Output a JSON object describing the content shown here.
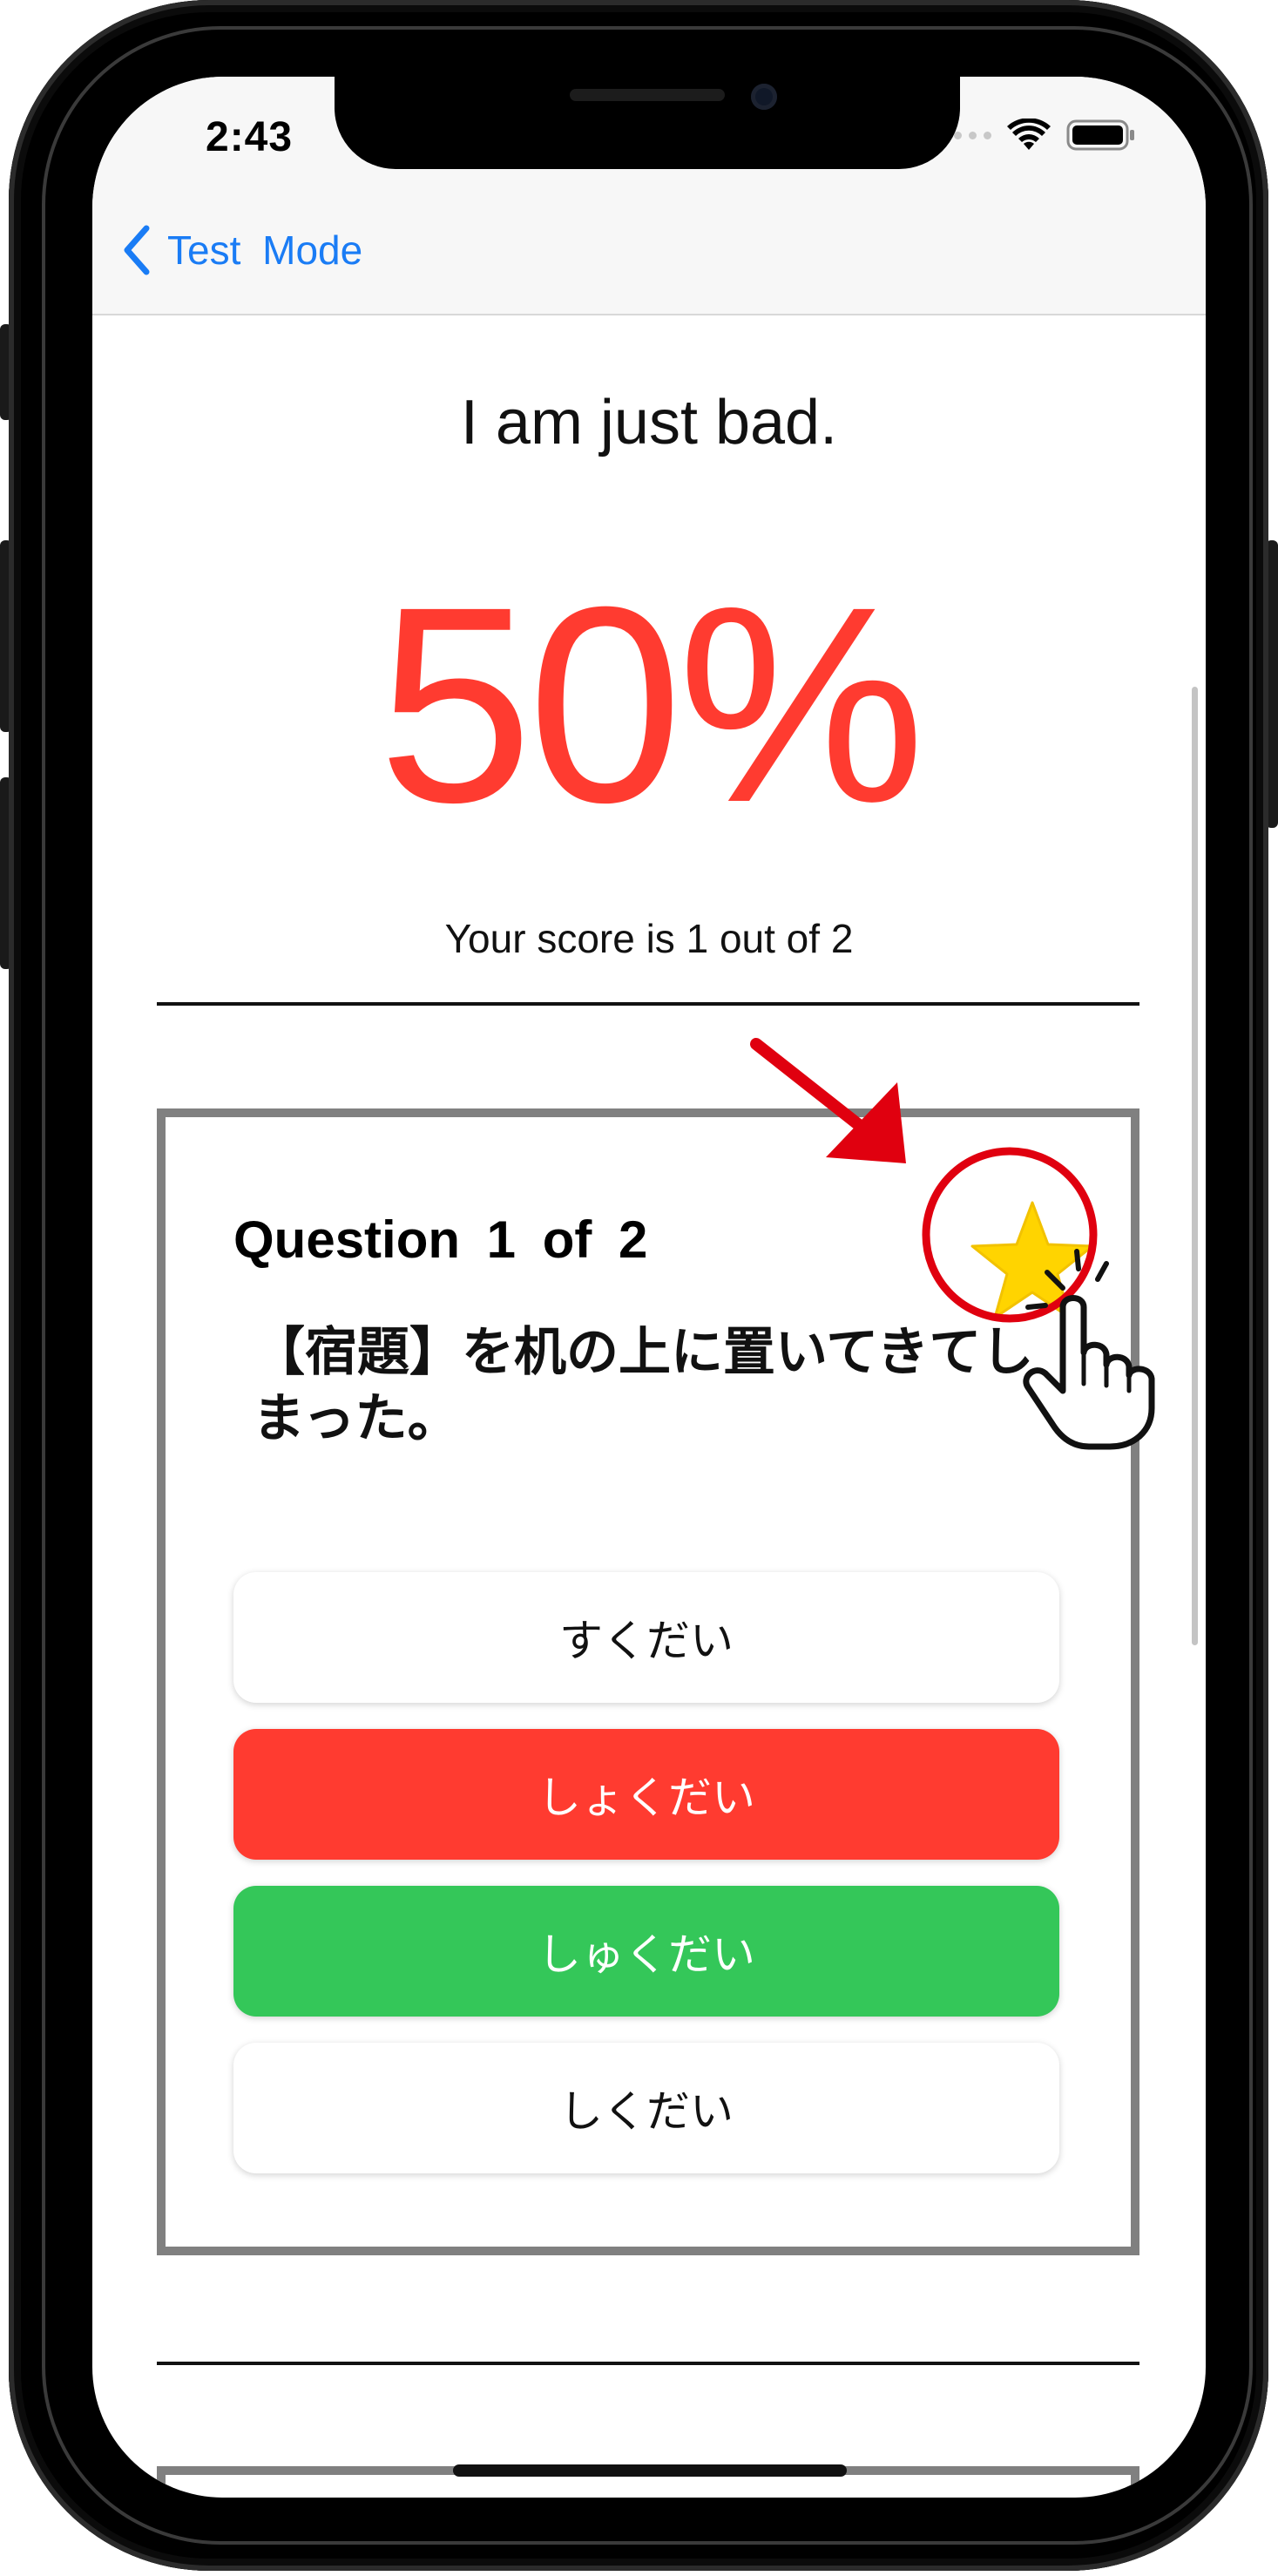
{
  "status_bar": {
    "time": "2:43"
  },
  "nav": {
    "back_label": "Test Mode",
    "back_icon": "chevron-left-icon"
  },
  "result": {
    "title": "I am just bad.",
    "percent": "50%",
    "caption": "Your score is 1 out of 2"
  },
  "question": {
    "number_label": "Question 1 of 2",
    "text": "【宿題】を机の上に置いてきてしまった。",
    "favorite_icon": "star-icon",
    "choices": [
      {
        "label": "すくだい",
        "state": "neutral"
      },
      {
        "label": "しょくだい",
        "state": "wrong"
      },
      {
        "label": "しゅくだい",
        "state": "correct"
      },
      {
        "label": "しくだい",
        "state": "neutral"
      }
    ]
  },
  "colors": {
    "accent_blue": "#1a7cf5",
    "score_red": "#ff3b30",
    "wrong_red": "#ff3b30",
    "correct_green": "#34c759",
    "card_border": "#808080",
    "star_yellow": "#ffd400",
    "annotation_red": "#e0000f"
  },
  "annotations": {
    "arrow_icon": "red-arrow-icon",
    "tap_icon": "tap-hand-icon",
    "highlight_icon": "red-circle-highlight"
  }
}
